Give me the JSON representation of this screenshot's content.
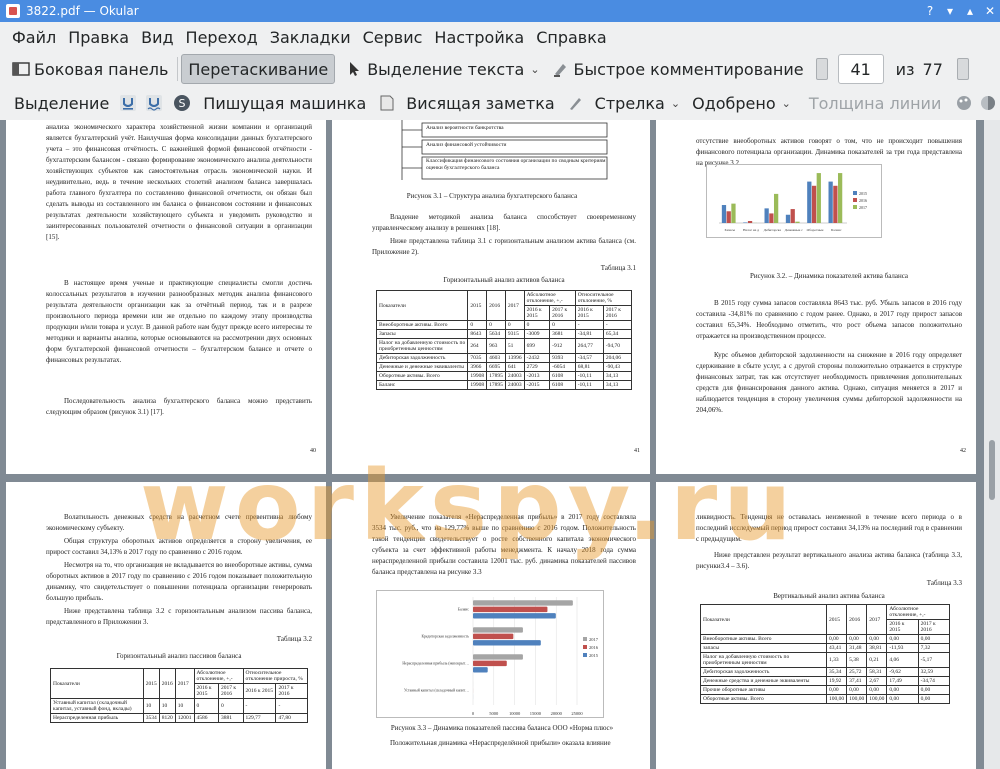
{
  "window": {
    "title": "3822.pdf — Okular"
  },
  "menu": [
    "Файл",
    "Правка",
    "Вид",
    "Переход",
    "Закладки",
    "Сервис",
    "Настройка",
    "Справка"
  ],
  "toolbar1": {
    "sidebar": "Боковая панель",
    "drag": "Перетаскивание",
    "text_select": "Выделение текста",
    "quick_comment": "Быстрое комментирование",
    "page_current": "41",
    "page_of": "из",
    "page_total": "77"
  },
  "toolbar2": {
    "highlight": "Выделение",
    "typewriter": "Пишущая машинка",
    "sticky_note": "Висящая заметка",
    "arrow": "Стрелка",
    "stamp": "Одобрено",
    "line_width": "Толщина линии"
  },
  "pages": {
    "p40": {
      "text1": "анализа экономического характера хозяйственной жизни компании и организаций является бухгалтерский учёт. Наилучшая форма консолидации данных бухгалтерского учета – это финансовая отчётность. С важнейшей формой финансовой отчётности - бухгалтерским балансом - связано формирование экономического анализа деятельности хозяйствующих субъектов как самостоятельная отрасль экономической науки. И неудивительно, ведь в течение нескольких столетий анализом баланса завершалась работа главного бухгалтера по составлению финансовой отчетности, он обязан был сделать выводы из составленного им баланса о финансовом состоянии и финансовых результатах деятельности хозяйствующего субъекта и уведомить руководство и заинтересованных пользователей отчетности о финансовой ситуации в организации [15].",
      "text2": "В настоящее время ученые и практикующие специалисты смогли достичь колоссальных результатов в изучении разнообразных методик анализа финансового результата деятельности организации как за отчётный период, так и в разрезе произвольного периода времени или же отдельно по каждому этапу производства продукции и/или товара и услуг. В данной работе нам будут прежде всего интересны те методики и варианты анализа, которые основываются на рассмотрении двух основных форм бухгалтерской финансовой отчетности – бухгалтерском балансе и отчете о финансовых результатах.",
      "text3": "Последовательность анализа бухгалтерского баланса можно представить следующим образом (рисунок 3.1) [17].",
      "number": "40"
    },
    "p41": {
      "box1": "Анализ вероятности банкротства",
      "box2": "Анализ финансовой устойчивости",
      "box3": "Классификация финансового состояния организации по сводным критериям оценки бухгалтерского баланса",
      "caption": "Рисунок 3.1 – Структура анализа бухгалтерского баланса",
      "text1": "Владение методикой анализа баланса способствует своевременному управленческому анализу в решениях [18].",
      "text2": "Ниже представлена таблица 3.1 с горизонтальным анализом актива баланса (см. Приложение 2).",
      "table_label": "Таблица 3.1",
      "table_title": "Горизонтальный анализ активов баланса",
      "number": "41"
    },
    "p42": {
      "text1": "отсутствие внеоборотных активов говорят о том, что не происходит повышения финансового потенциала организации. Динамика показателей за три года представлена на рисунке 3.2.",
      "caption": "Рисунок 3.2. – Динамика показателей актива баланса",
      "text2": "В 2015 году сумма запасов составляла 8643 тыс. руб. Убыль запасов в 2016 году составила -34,81% по сравнению с годом ранее. Однако, в 2017 году прирост запасов составил 65,34%. Необходимо отметить, что рост объема запасов положительно отражается на производственном процессе.",
      "text3": "Курс объемов дебиторской задолженности на снижение в 2016 году определяет сдерживание в сбыте услуг, а с другой стороны положительно отражается в структуре финансовых затрат, так как отсутствует необходимость привлечения дополнительных средств для финансирования данного актива. Однако, ситуация меняется в 2017 и наблюдается тенденция в сторону увеличения суммы дебиторской задолженности на 204,06%.",
      "number": "42"
    },
    "p43": {
      "text1": "Волатильность денежных средств на расчетном счете превентивна любому экономическому субъекту.",
      "text2": "Общая структура оборотных активов определяется в сторону увеличения, ее прирост составил 34,13% в 2017 году по сравнению с 2016 годом.",
      "text3": "Несмотря на то, что организация не вкладывается во внеоборотные активы, сумма оборотных активов в 2017 году по сравнению с 2016 годом показывает положительную динамику, что свидетельствует о повышении потенциала организации генерировать большую прибыль.",
      "text4": "Ниже представлена таблица 3.2 с горизонтальным анализом пассива баланса, представленного в Приложении 3.",
      "table_label": "Таблица 3.2",
      "table_title": "Горизонтальный анализ пассивов баланса"
    },
    "p44": {
      "text1": "Увеличение показателя «Нераспределенная прибыль» в 2017 году составляла 3534 тыс. руб., что на 129,77% выше по сравнению с 2016 годом. Положительность такой тенденции свидетельствует о росте собственного капитала экономического субъекта за счет эффективной работы менеджмента. К началу 2018 года сумма нераспределенной прибыли составила 12001 тыс. руб. динамика показателей пассивов баланса представлена на рисунке 3.3",
      "caption": "Рисунок 3.3 – Динамика показателей пассива баланса ООО «Норма плюс»",
      "text2": "Положительная динамика «Нераспределённой прибыли» оказала влияние"
    },
    "p45": {
      "text1": "ликвидность. Тенденция не оставалась неизменной в течение всего периода о в последний исследуемый период прирост составил 34,13% на последний год в сравнении с предыдущим.",
      "text2": "Ниже представлен результат вертикального анализа актива баланса (таблица 3.3, рисунки3.4 – 3.6).",
      "table_label": "Таблица 3.3",
      "table_title": "Вертикальный анализ актива баланса"
    }
  },
  "table31": {
    "head": [
      "Показатели",
      "2015",
      "2016",
      "2017",
      "Абсолютное отклонение, +,-",
      "Относительное отклонение, %"
    ],
    "rows": [
      [
        "Внеоборотные активы. Всего",
        "0",
        "0",
        "0",
        "0",
        "0",
        "-",
        "-"
      ],
      [
        "Запасы",
        "8643",
        "5634",
        "9315",
        "-3009",
        "3681",
        "-34,81",
        "65,34"
      ],
      [
        "Налог на добавленную стоимость по приобретенным ценностям",
        "264",
        "963",
        "51",
        "699",
        "-912",
        "264,77",
        "-94,70"
      ],
      [
        "Дебиторская задолженность",
        "7035",
        "4603",
        "13996",
        "-2432",
        "9393",
        "-34,57",
        "204,06"
      ],
      [
        "Денежные и денежные эквиваленты",
        "3966",
        "6695",
        "641",
        "2729",
        "-6054",
        "68,81",
        "-90,43"
      ],
      [
        "Оборотные активы. Всего",
        "19908",
        "17895",
        "24003",
        "-2013",
        "6108",
        "-10,11",
        "34,13"
      ],
      [
        "Баланс",
        "19908",
        "17895",
        "24003",
        "-2015",
        "6108",
        "-10,11",
        "34,13"
      ]
    ]
  },
  "table32": {
    "head": [
      "Показатели",
      "2015",
      "2016",
      "2017",
      "Абсолютное отклонение, +,-",
      "Относительное отклонение прироста, %"
    ],
    "rows": [
      [
        "Уставный капитал (складочный капитал, уставный фонд, вклады)",
        "10",
        "10",
        "10",
        "0",
        "0",
        "-",
        "-"
      ],
      [
        "Нераспределенная прибыль",
        "3534",
        "8120",
        "12001",
        "4586",
        "3881",
        "129,77",
        "47,80"
      ]
    ]
  },
  "table33": {
    "head": [
      "Показатели",
      "2015",
      "2016",
      "2017",
      "Абсолютное отклонение, +,-"
    ],
    "rows": [
      [
        "Внеоборотные активы. Всего",
        "0,00",
        "0,00",
        "0,00",
        "0,00",
        "0,00"
      ],
      [
        "запасы",
        "43,41",
        "31,48",
        "38,81",
        "-11,93",
        "7,32"
      ],
      [
        "Налог на добавленную стоимость по приобретенным ценностям",
        "1,33",
        "5,38",
        "0,21",
        "4,06",
        "-5,17"
      ],
      [
        "Дебиторская задолженность",
        "35,34",
        "25,72",
        "58,31",
        "-9,62",
        "32,59"
      ],
      [
        "Денежные средства и денежные эквиваленты",
        "19,92",
        "37,41",
        "2,67",
        "17,49",
        "-34,74"
      ],
      [
        "Прочие оборотные активы",
        "0,00",
        "0,00",
        "0,00",
        "0,00",
        "0,00"
      ],
      [
        "Оборотные активы. Всего",
        "100,00",
        "100,00",
        "100,00",
        "0,00",
        "0,00"
      ]
    ]
  },
  "chart_data": [
    {
      "type": "bar",
      "categories": [
        "Запасы",
        "Налог на добавленную",
        "Дебиторская задолженность",
        "Денежные средства",
        "Оборотные активы",
        "Баланс"
      ],
      "series": [
        {
          "name": "2015",
          "values": [
            8643,
            264,
            7035,
            3966,
            19908,
            19908
          ]
        },
        {
          "name": "2016",
          "values": [
            5634,
            963,
            4603,
            6695,
            17895,
            17895
          ]
        },
        {
          "name": "2017",
          "values": [
            9315,
            51,
            13996,
            641,
            24003,
            24003
          ]
        }
      ],
      "colors": [
        "#4f81bd",
        "#c0504d",
        "#9bbb59"
      ]
    },
    {
      "type": "bar",
      "orientation": "horizontal",
      "categories": [
        "Баланс",
        "Кредиторская задолженность",
        "Нераспределенная прибыль (непокрытый убыток)",
        "Уставный капитал (складочный капитал, уставный фонд, вклады)"
      ],
      "series": [
        {
          "name": "2017",
          "values": [
            24003,
            12000,
            12001,
            10
          ]
        },
        {
          "name": "2016",
          "values": [
            17895,
            9700,
            8120,
            10
          ]
        },
        {
          "name": "2015",
          "values": [
            19908,
            16300,
            3534,
            10
          ]
        }
      ],
      "xticks": [
        "0",
        "5000",
        "10000",
        "15000",
        "20000",
        "25000"
      ],
      "xlim": [
        0,
        25000
      ],
      "colors": [
        "#a5a5a5",
        "#c0504d",
        "#4f81bd"
      ]
    }
  ],
  "watermark": "workspy.ru"
}
